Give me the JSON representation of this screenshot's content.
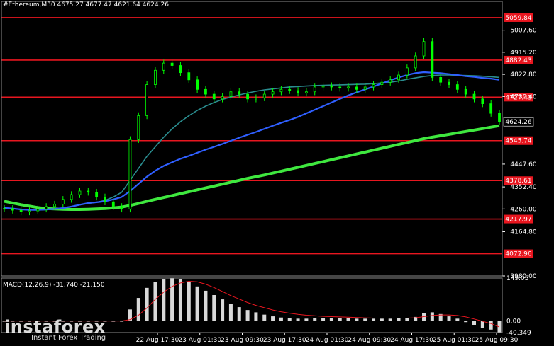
{
  "header": {
    "symbol": "#Ethereum,M30",
    "ohlc": "4675.27 4677.47 4621.64 4624.26"
  },
  "colors": {
    "background": "#000000",
    "price_line": "#00ff00",
    "ma_fast": "#2f5fff",
    "ma_mid": "#2a8d8f",
    "ma_slow": "#3fe83f",
    "level": "#e8161f"
  },
  "chart_data": [
    {
      "type": "line",
      "title": "#Ethereum,M30",
      "ylim": [
        3980.0,
        5110.0
      ],
      "yticks": [
        5007.6,
        4915.2,
        4822.8,
        4730.4,
        4447.6,
        4352.4,
        4260.0,
        4164.8,
        3980.0
      ],
      "xticks": [
        "22 Aug 17:30",
        "23 Aug 01:30",
        "23 Aug 09:30",
        "23 Aug 17:30",
        "24 Aug 01:30",
        "24 Aug 09:30",
        "24 Aug 17:30",
        "25 Aug 01:30",
        "25 Aug 09:30"
      ],
      "current_price": "4624.26",
      "levels": [
        "5059.84",
        "4882.43",
        "4727.43",
        "4545.74",
        "4378.61",
        "4217.97",
        "4072.96"
      ],
      "series": [
        {
          "role": "price",
          "values": [
            4262,
            4255,
            4248,
            4252,
            4260,
            4270,
            4280,
            4300,
            4320,
            4335,
            4330,
            4310,
            4290,
            4270,
            4260,
            4550,
            4650,
            4780,
            4840,
            4870,
            4860,
            4830,
            4800,
            4760,
            4740,
            4720,
            4730,
            4750,
            4740,
            4720,
            4725,
            4740,
            4750,
            4760,
            4755,
            4745,
            4750,
            4770,
            4775,
            4770,
            4765,
            4770,
            4760,
            4770,
            4780,
            4790,
            4800,
            4820,
            4850,
            4900,
            4960,
            4810,
            4790,
            4780,
            4760,
            4740,
            4720,
            4700,
            4660,
            4624
          ]
        },
        {
          "role": "ma_fast",
          "values": [
            4265,
            4262,
            4258,
            4256,
            4256,
            4258,
            4260,
            4264,
            4270,
            4278,
            4285,
            4288,
            4292,
            4300,
            4310,
            4335,
            4365,
            4395,
            4420,
            4440,
            4455,
            4470,
            4482,
            4495,
            4508,
            4520,
            4532,
            4545,
            4558,
            4570,
            4582,
            4595,
            4608,
            4620,
            4632,
            4645,
            4660,
            4675,
            4690,
            4705,
            4720,
            4735,
            4748,
            4760,
            4772,
            4785,
            4798,
            4810,
            4820,
            4828,
            4832,
            4830,
            4828,
            4824,
            4820,
            4815,
            4812,
            4808,
            4805,
            4800
          ]
        },
        {
          "role": "ma_mid",
          "values": [
            4264,
            4261,
            4258,
            4256,
            4256,
            4257,
            4260,
            4264,
            4270,
            4277,
            4283,
            4288,
            4296,
            4310,
            4330,
            4380,
            4430,
            4480,
            4520,
            4560,
            4595,
            4625,
            4650,
            4672,
            4690,
            4705,
            4718,
            4728,
            4737,
            4745,
            4752,
            4758,
            4762,
            4766,
            4770,
            4772,
            4774,
            4776,
            4777,
            4778,
            4779,
            4780,
            4781,
            4782,
            4784,
            4787,
            4790,
            4795,
            4802,
            4808,
            4814,
            4818,
            4820,
            4820,
            4819,
            4818,
            4817,
            4815,
            4813,
            4810
          ]
        },
        {
          "role": "ma_slow",
          "values": [
            4292,
            4285,
            4278,
            4272,
            4266,
            4262,
            4260,
            4259,
            4258,
            4258,
            4259,
            4260,
            4262,
            4265,
            4268,
            4275,
            4283,
            4292,
            4300,
            4308,
            4316,
            4324,
            4332,
            4340,
            4348,
            4356,
            4364,
            4372,
            4380,
            4388,
            4395,
            4402,
            4410,
            4418,
            4426,
            4434,
            4442,
            4450,
            4458,
            4466,
            4474,
            4482,
            4490,
            4498,
            4506,
            4514,
            4522,
            4530,
            4538,
            4546,
            4554,
            4560,
            4566,
            4572,
            4578,
            4584,
            4590,
            4596,
            4602,
            4608
          ]
        }
      ]
    },
    {
      "type": "bar",
      "title": "MACD(12,26,9) -31.740 -21.150",
      "ylim": [
        -40.349,
        149.05
      ],
      "yticks": [
        149.05,
        0.0,
        -40.349
      ],
      "values": [
        0,
        0,
        0,
        0,
        0,
        0,
        0,
        0,
        0,
        0,
        0,
        0,
        0,
        0,
        0,
        40,
        80,
        115,
        135,
        145,
        149,
        145,
        135,
        120,
        105,
        90,
        75,
        60,
        48,
        38,
        30,
        22,
        16,
        12,
        9,
        8,
        8,
        9,
        10,
        11,
        10,
        9,
        8,
        8,
        8,
        8,
        8,
        9,
        10,
        14,
        28,
        30,
        24,
        16,
        8,
        -4,
        -14,
        -24,
        -30,
        -40
      ],
      "signal": [
        0,
        0,
        0,
        0,
        0,
        0,
        0,
        0,
        0,
        0,
        0,
        0,
        0,
        0,
        0,
        5,
        20,
        45,
        75,
        100,
        120,
        132,
        138,
        136,
        128,
        116,
        102,
        88,
        76,
        64,
        54,
        46,
        38,
        32,
        27,
        23,
        20,
        18,
        16,
        15,
        14,
        13,
        12,
        11,
        10,
        10,
        10,
        10,
        10,
        11,
        15,
        19,
        21,
        21,
        19,
        14,
        7,
        -1,
        -9,
        -21
      ]
    }
  ],
  "macd_label": "MACD(12,26,9) -31.740 -21.150",
  "macd_levels": [
    "149.05",
    "0.00",
    "-40.349"
  ],
  "logo": {
    "brand": "instaforex",
    "tagline": "Instant Forex Trading"
  }
}
